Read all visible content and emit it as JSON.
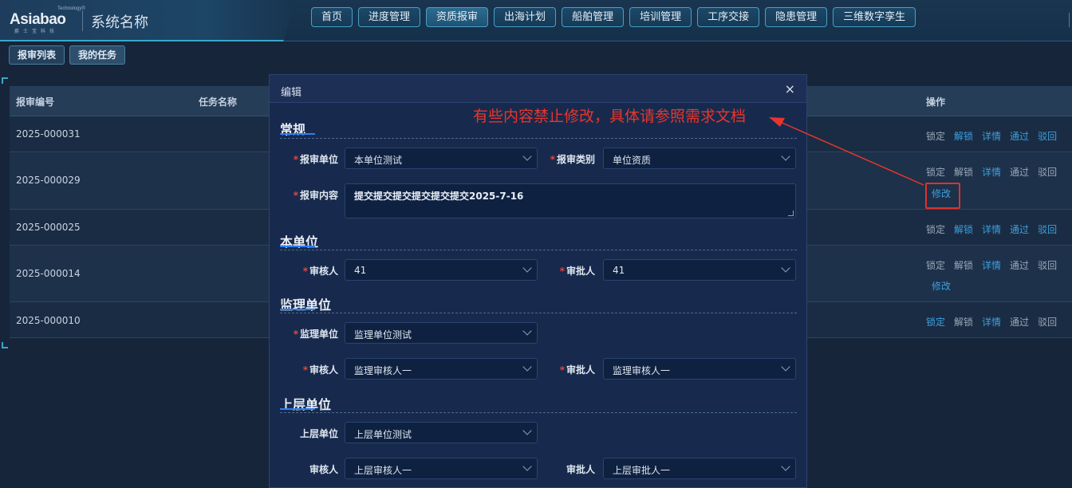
{
  "app": {
    "logo_tech": "Technology®",
    "logo_text": "Asiabao",
    "logo_sub": "爵士宝科技",
    "system_name": "系统名称"
  },
  "nav": {
    "items": [
      {
        "label": "首页"
      },
      {
        "label": "进度管理"
      },
      {
        "label": "资质报审",
        "active": true
      },
      {
        "label": "出海计划"
      },
      {
        "label": "船舶管理"
      },
      {
        "label": "培训管理"
      },
      {
        "label": "工序交接"
      },
      {
        "label": "隐患管理"
      },
      {
        "label": "三维数字孪生"
      }
    ]
  },
  "subtabs": [
    {
      "label": "报审列表"
    },
    {
      "label": "我的任务",
      "active": true
    }
  ],
  "table": {
    "headers": {
      "id": "报审编号",
      "task": "任务名称",
      "ops": "操作"
    },
    "rows": [
      {
        "id": "2025-000031",
        "ops": [
          {
            "label": "锁定",
            "link": false
          },
          {
            "label": "解锁",
            "link": true
          },
          {
            "label": "详情",
            "link": true
          },
          {
            "label": "通过",
            "link": true
          },
          {
            "label": "驳回",
            "link": true
          }
        ],
        "extra": ""
      },
      {
        "id": "2025-000029",
        "ops": [
          {
            "label": "锁定",
            "link": false
          },
          {
            "label": "解锁",
            "link": false
          },
          {
            "label": "详情",
            "link": true
          },
          {
            "label": "通过",
            "link": false
          },
          {
            "label": "驳回",
            "link": false
          }
        ],
        "extra": "修改"
      },
      {
        "id": "2025-000025",
        "ops": [
          {
            "label": "锁定",
            "link": false
          },
          {
            "label": "解锁",
            "link": true
          },
          {
            "label": "详情",
            "link": true
          },
          {
            "label": "通过",
            "link": true
          },
          {
            "label": "驳回",
            "link": true
          }
        ],
        "extra": ""
      },
      {
        "id": "2025-000014",
        "ops": [
          {
            "label": "锁定",
            "link": false
          },
          {
            "label": "解锁",
            "link": false
          },
          {
            "label": "详情",
            "link": true
          },
          {
            "label": "通过",
            "link": false
          },
          {
            "label": "驳回",
            "link": false
          }
        ],
        "extra": "修改"
      },
      {
        "id": "2025-000010",
        "ops": [
          {
            "label": "锁定",
            "link": true
          },
          {
            "label": "解锁",
            "link": false
          },
          {
            "label": "详情",
            "link": true
          },
          {
            "label": "通过",
            "link": false
          },
          {
            "label": "驳回",
            "link": false
          }
        ],
        "extra": ""
      }
    ]
  },
  "modal": {
    "title": "编辑",
    "close": "×",
    "sections": {
      "general": "常规",
      "own_unit": "本单位",
      "supervision": "监理单位",
      "upper": "上层单位"
    },
    "fields": {
      "unit_label": "报审单位",
      "unit_value": "本单位测试",
      "type_label": "报审类别",
      "type_value": "单位资质",
      "content_label": "报审内容",
      "content_value": "提交提交提交提交提交提交2025-7-16",
      "own_reviewer_label": "审核人",
      "own_reviewer_value": "41",
      "own_approver_label": "审批人",
      "own_approver_value": "41",
      "sup_unit_label": "监理单位",
      "sup_unit_value": "监理单位测试",
      "sup_reviewer_label": "审核人",
      "sup_reviewer_value": "监理审核人一",
      "sup_approver_label": "审批人",
      "sup_approver_value": "监理审核人一",
      "up_unit_label": "上层单位",
      "up_unit_value": "上层单位测试",
      "up_reviewer_label": "审核人",
      "up_reviewer_value": "上层审核人一",
      "up_approver_label": "审批人",
      "up_approver_value": "上层审批人一"
    }
  },
  "annotation": {
    "text": "有些内容禁止修改，具体请参照需求文档",
    "color": "#e8352c"
  }
}
